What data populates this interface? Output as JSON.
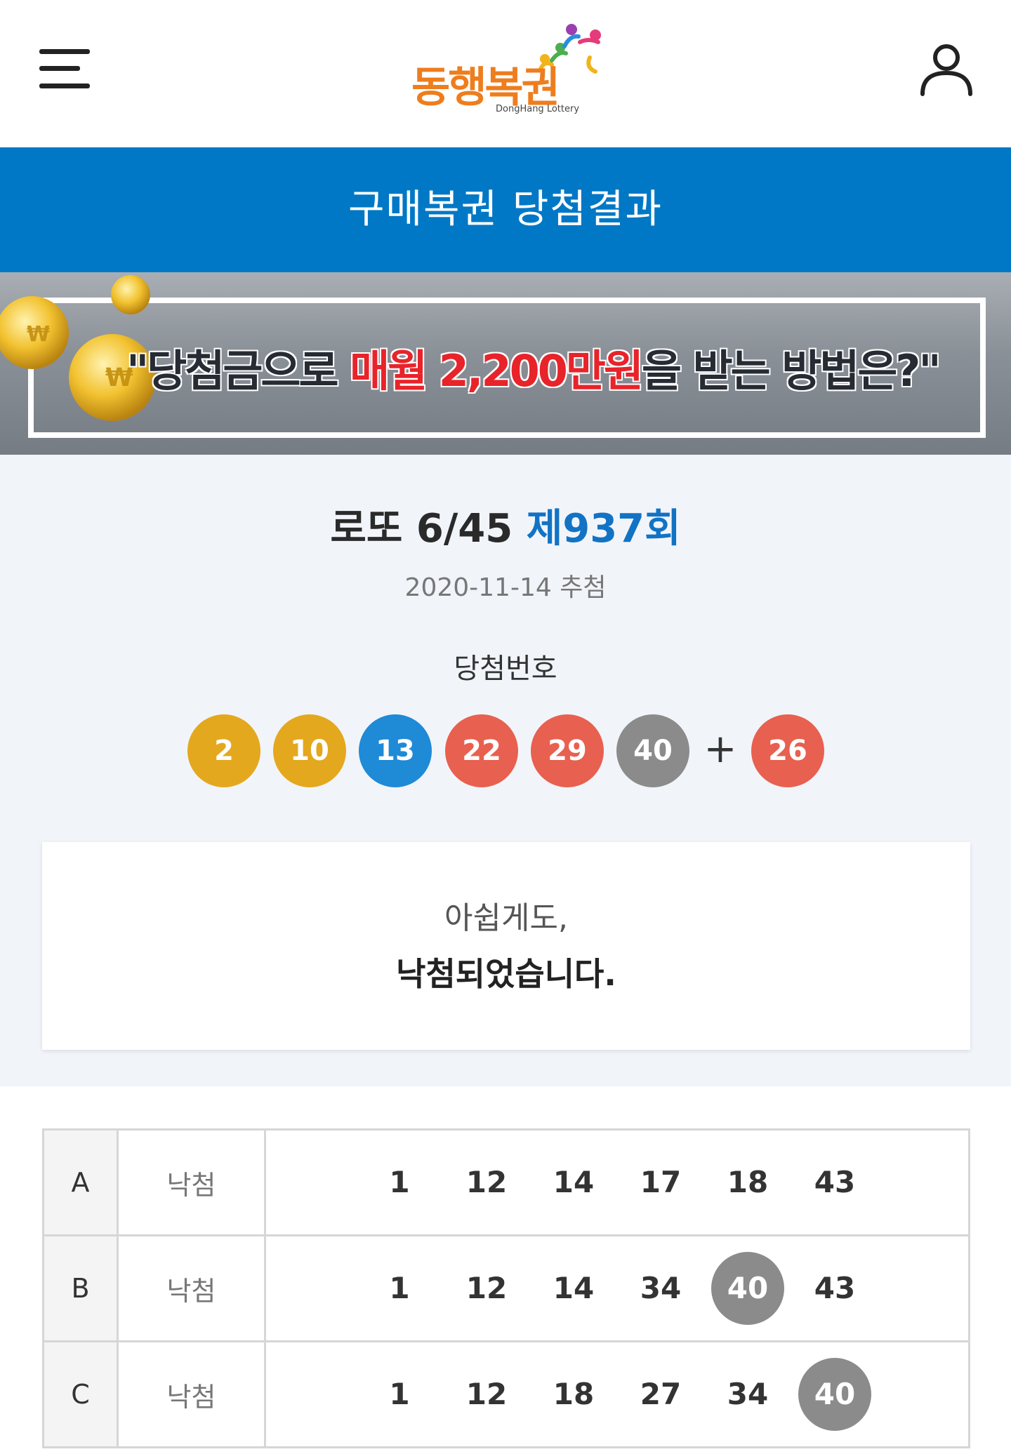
{
  "header": {
    "logo_text": "동행복권",
    "logo_sub": "DongHang Lottery"
  },
  "titlebar": {
    "title": "구매복권 당첨결과"
  },
  "banner": {
    "text_before": "\"당첨금으로 ",
    "text_highlight": "매월 2,200만원",
    "text_after": "을 받는 방법은?\""
  },
  "result": {
    "game_name": "로또 6/45",
    "round": "제937회",
    "draw_date": "2020-11-14 추첨",
    "winning_label": "당첨번호",
    "winning_numbers": [
      {
        "value": "2",
        "color": "#e4a81e"
      },
      {
        "value": "10",
        "color": "#e4a81e"
      },
      {
        "value": "13",
        "color": "#1f8ad6"
      },
      {
        "value": "22",
        "color": "#e8604f"
      },
      {
        "value": "29",
        "color": "#e8604f"
      },
      {
        "value": "40",
        "color": "#8b8b8b"
      }
    ],
    "plus": "+",
    "bonus": {
      "value": "26",
      "color": "#e8604f"
    },
    "message_line1": "아쉽게도,",
    "message_line2": "낙첨되었습니다."
  },
  "tickets": [
    {
      "label": "A",
      "status": "낙첨",
      "numbers": [
        "1",
        "12",
        "14",
        "17",
        "18",
        "43"
      ],
      "matched": [
        false,
        false,
        false,
        false,
        false,
        false
      ]
    },
    {
      "label": "B",
      "status": "낙첨",
      "numbers": [
        "1",
        "12",
        "14",
        "34",
        "40",
        "43"
      ],
      "matched": [
        false,
        false,
        false,
        false,
        true,
        false
      ]
    },
    {
      "label": "C",
      "status": "낙첨",
      "numbers": [
        "1",
        "12",
        "18",
        "27",
        "34",
        "40"
      ],
      "matched": [
        false,
        false,
        false,
        false,
        false,
        true
      ]
    }
  ],
  "colors": {
    "brand_blue": "#0078c6",
    "round_blue": "#1273c5",
    "logo_orange": "#ee7d1d",
    "banner_red": "#e8232a"
  }
}
